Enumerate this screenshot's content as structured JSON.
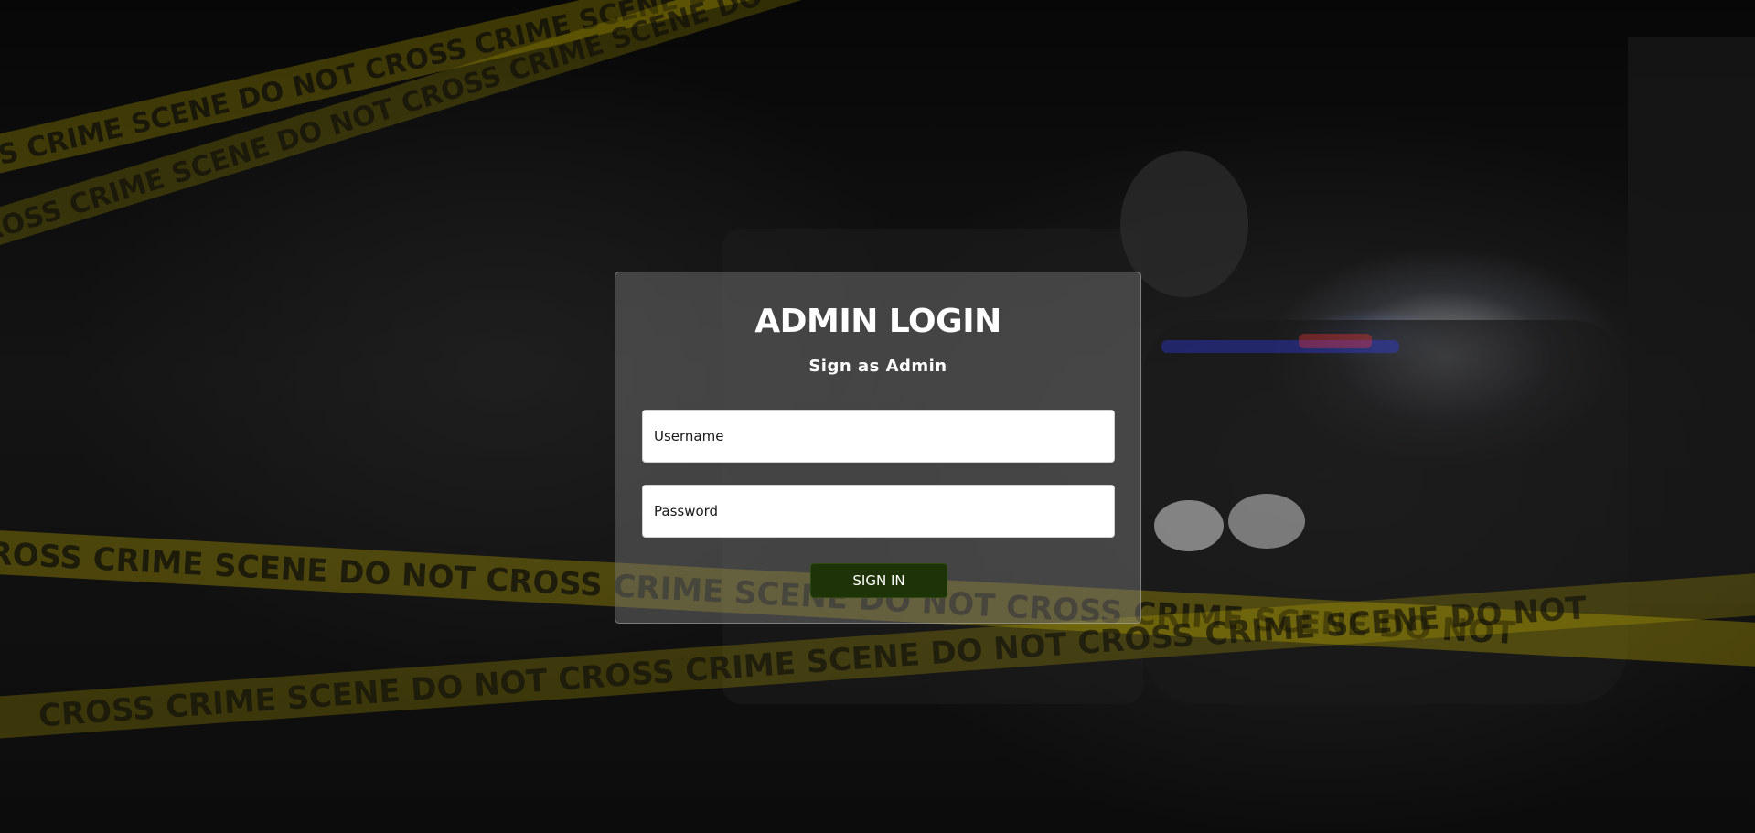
{
  "background": {
    "tape_text": "CROSS CRIME SCENE DO NOT CROSS CRIME SCENE DO NOT CROSS CRIME SCENE DO NOT",
    "tape_color": "#c9b400"
  },
  "login": {
    "title": "ADMIN LOGIN",
    "subtitle": "Sign as Admin",
    "username_placeholder": "Username",
    "username_value": "",
    "password_placeholder": "Password",
    "password_value": "",
    "submit_label": "SIGN IN"
  },
  "colors": {
    "card_bg": "rgba(128,128,128,0.42)",
    "button_bg": "#1e3308",
    "text": "#ffffff"
  }
}
